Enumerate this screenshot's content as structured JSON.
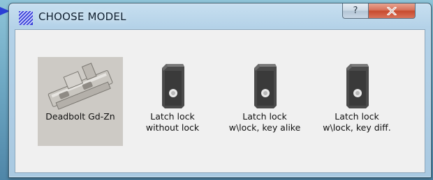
{
  "window": {
    "title": "CHOOSE MODEL",
    "help_label": "?",
    "close_label": "x"
  },
  "models": [
    {
      "label": "Deadbolt Gd-Zn",
      "icon": "deadbolt-icon",
      "selected": true
    },
    {
      "label": "Latch lock without lock",
      "icon": "latch-lock-icon",
      "selected": false
    },
    {
      "label": "Latch lock w\\lock, key alike",
      "icon": "latch-lock-icon",
      "selected": false
    },
    {
      "label": "Latch lock w\\lock, key diff.",
      "icon": "latch-lock-icon",
      "selected": false
    }
  ],
  "colors": {
    "selected_bg": "#cdcac5",
    "close_button": "#c74a2e",
    "pointer_arrow": "#2b3fd6"
  }
}
